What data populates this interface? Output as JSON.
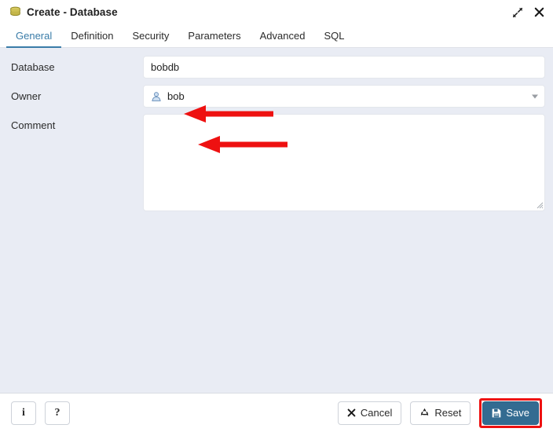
{
  "window": {
    "title": "Create - Database",
    "icon": "database-icon",
    "expand_icon": "expand-icon",
    "close_icon": "close-icon"
  },
  "tabs": [
    {
      "label": "General",
      "active": true
    },
    {
      "label": "Definition",
      "active": false
    },
    {
      "label": "Security",
      "active": false
    },
    {
      "label": "Parameters",
      "active": false
    },
    {
      "label": "Advanced",
      "active": false
    },
    {
      "label": "SQL",
      "active": false
    }
  ],
  "form": {
    "database": {
      "label": "Database",
      "value": "bobdb",
      "placeholder": ""
    },
    "owner": {
      "label": "Owner",
      "value": "bob",
      "icon": "user-icon"
    },
    "comment": {
      "label": "Comment",
      "value": "",
      "placeholder": ""
    }
  },
  "footer": {
    "info_label": "i",
    "help_label": "?",
    "cancel_label": "Cancel",
    "reset_label": "Reset",
    "save_label": "Save"
  },
  "colors": {
    "accent": "#3a7ca8",
    "primary_button": "#336b91",
    "form_background": "#e9ecf4",
    "annotation": "#ee1111",
    "db_icon": "#c8b84a"
  },
  "annotations": {
    "database_arrow": "red-arrow-left",
    "owner_arrow": "red-arrow-left",
    "save_highlight": "red-rectangle"
  }
}
